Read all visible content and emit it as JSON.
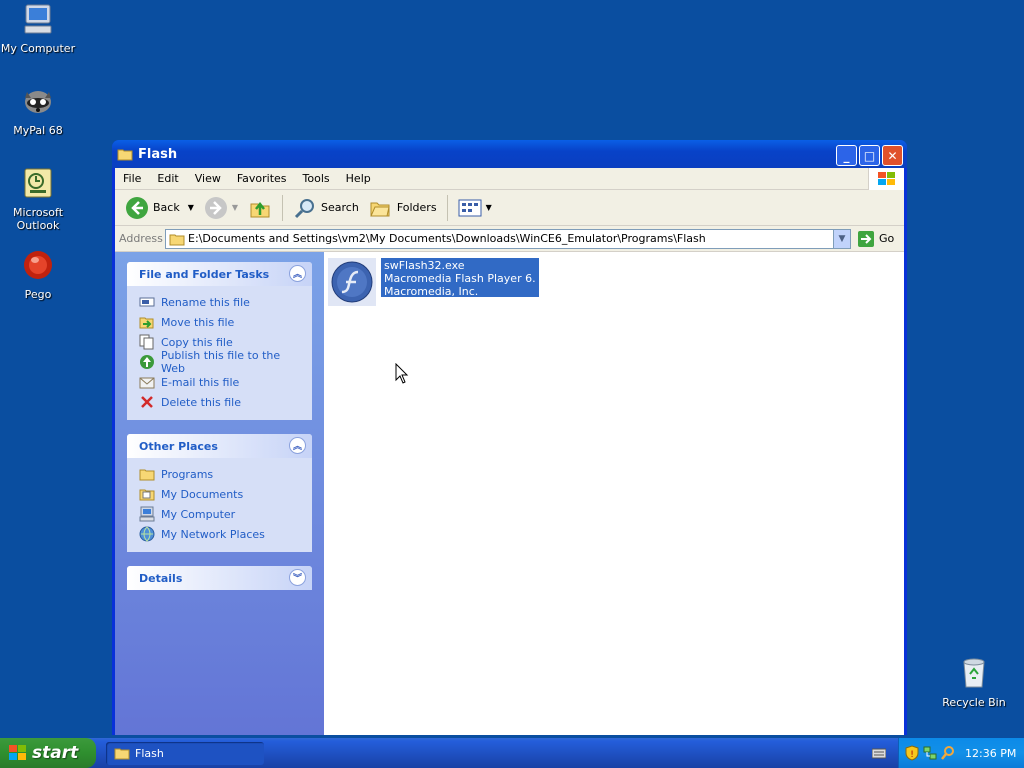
{
  "desktop": {
    "icons": [
      {
        "label": "My Computer"
      },
      {
        "label": "MyPal 68"
      },
      {
        "label": "Microsoft Outlook"
      },
      {
        "label": "Pego"
      },
      {
        "label": "Recycle Bin"
      }
    ]
  },
  "window": {
    "title": "Flash",
    "menu": [
      "File",
      "Edit",
      "View",
      "Favorites",
      "Tools",
      "Help"
    ],
    "toolbar": {
      "back": "Back",
      "search": "Search",
      "folders": "Folders"
    },
    "address": {
      "label": "Address",
      "path": "E:\\Documents and Settings\\vm2\\My Documents\\Downloads\\WinCE6_Emulator\\Programs\\Flash",
      "go": "Go"
    },
    "tasks_panel": {
      "title": "File and Folder Tasks",
      "items": [
        "Rename this file",
        "Move this file",
        "Copy this file",
        "Publish this file to the Web",
        "E-mail this file",
        "Delete this file"
      ]
    },
    "places_panel": {
      "title": "Other Places",
      "items": [
        "Programs",
        "My Documents",
        "My Computer",
        "My Network Places"
      ]
    },
    "details_panel": {
      "title": "Details"
    },
    "file": {
      "name": "swFlash32.exe",
      "description": "Macromedia Flash Player 6.0  ...",
      "company": "Macromedia, Inc."
    }
  },
  "taskbar": {
    "start": "start",
    "active_task": "Flash",
    "clock": "12:36 PM"
  },
  "colors": {
    "desktop": "#0a4ea0",
    "selection": "#316ac5",
    "task_link": "#215dc6"
  }
}
